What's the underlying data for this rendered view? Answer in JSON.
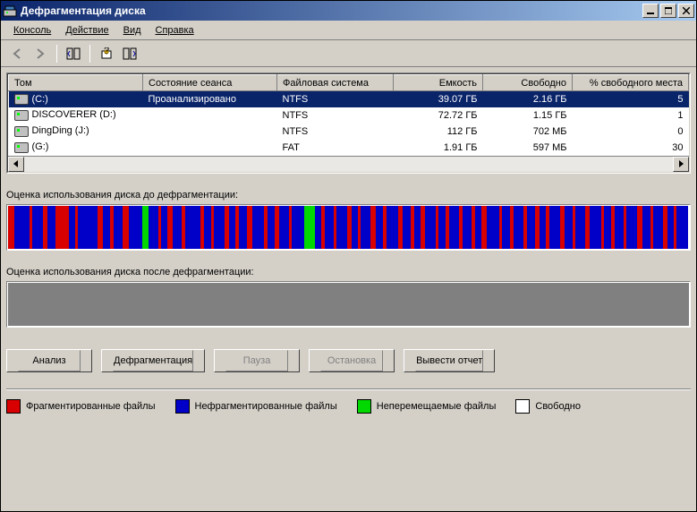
{
  "window": {
    "title": "Дефрагментация диска"
  },
  "menu": {
    "console": "Консоль",
    "action": "Действие",
    "view": "Вид",
    "help": "Справка"
  },
  "columns": {
    "volume": "Том",
    "session": "Состояние сеанса",
    "fs": "Файловая система",
    "capacity": "Емкость",
    "free": "Свободно",
    "pctfree": "% свободного места"
  },
  "rows": [
    {
      "volume": "(C:)",
      "session": "Проанализировано",
      "fs": "NTFS",
      "capacity": "39.07 ГБ",
      "free": "2.16 ГБ",
      "pctfree": "5",
      "selected": true
    },
    {
      "volume": "DISCOVERER (D:)",
      "session": "",
      "fs": "NTFS",
      "capacity": "72.72 ГБ",
      "free": "1.15 ГБ",
      "pctfree": "1",
      "selected": false
    },
    {
      "volume": "DingDing (J:)",
      "session": "",
      "fs": "NTFS",
      "capacity": "112 ГБ",
      "free": "702 МБ",
      "pctfree": "0",
      "selected": false
    },
    {
      "volume": "(G:)",
      "session": "",
      "fs": "FAT",
      "capacity": "1.91 ГБ",
      "free": "597 МБ",
      "pctfree": "30",
      "selected": false
    }
  ],
  "labels": {
    "before": "Оценка использования диска до дефрагментации:",
    "after": "Оценка использования диска после дефрагментации:"
  },
  "buttons": {
    "analyze": "Анализ",
    "defrag": "Дефрагментация",
    "pause": "Пауза",
    "stop": "Остановка",
    "report": "Вывести отчет"
  },
  "legend": {
    "fragmented": {
      "label": "Фрагментированные файлы",
      "color": "#d80000"
    },
    "contiguous": {
      "label": "Нефрагментированные файлы",
      "color": "#0000c8"
    },
    "unmovable": {
      "label": "Неперемещаемые файлы",
      "color": "#00d800"
    },
    "free": {
      "label": "Свободно",
      "color": "#ffffff"
    }
  },
  "chart_data": {
    "type": "bar",
    "title": "Оценка использования диска до дефрагментации",
    "categories_note": "Disk map stripes, color-coded by file state; widths are relative proportions of disk span.",
    "color_legend": {
      "red": "fragmented",
      "blue": "contiguous",
      "green": "unmovable",
      "white": "free"
    },
    "stripes": [
      {
        "c": "red",
        "w": 6
      },
      {
        "c": "blue",
        "w": 14
      },
      {
        "c": "red",
        "w": 3
      },
      {
        "c": "blue",
        "w": 10
      },
      {
        "c": "red",
        "w": 4
      },
      {
        "c": "blue",
        "w": 8
      },
      {
        "c": "red",
        "w": 12
      },
      {
        "c": "blue",
        "w": 6
      },
      {
        "c": "red",
        "w": 3
      },
      {
        "c": "blue",
        "w": 18
      },
      {
        "c": "red",
        "w": 5
      },
      {
        "c": "blue",
        "w": 7
      },
      {
        "c": "red",
        "w": 3
      },
      {
        "c": "blue",
        "w": 9
      },
      {
        "c": "red",
        "w": 6
      },
      {
        "c": "blue",
        "w": 12
      },
      {
        "c": "green",
        "w": 6
      },
      {
        "c": "blue",
        "w": 9
      },
      {
        "c": "red",
        "w": 3
      },
      {
        "c": "blue",
        "w": 6
      },
      {
        "c": "red",
        "w": 5
      },
      {
        "c": "blue",
        "w": 8
      },
      {
        "c": "red",
        "w": 4
      },
      {
        "c": "blue",
        "w": 14
      },
      {
        "c": "red",
        "w": 3
      },
      {
        "c": "blue",
        "w": 7
      },
      {
        "c": "red",
        "w": 3
      },
      {
        "c": "blue",
        "w": 10
      },
      {
        "c": "red",
        "w": 4
      },
      {
        "c": "blue",
        "w": 6
      },
      {
        "c": "red",
        "w": 3
      },
      {
        "c": "blue",
        "w": 8
      },
      {
        "c": "red",
        "w": 5
      },
      {
        "c": "blue",
        "w": 11
      },
      {
        "c": "red",
        "w": 3
      },
      {
        "c": "blue",
        "w": 7
      },
      {
        "c": "red",
        "w": 4
      },
      {
        "c": "blue",
        "w": 9
      },
      {
        "c": "red",
        "w": 3
      },
      {
        "c": "blue",
        "w": 12
      },
      {
        "c": "green",
        "w": 10
      },
      {
        "c": "blue",
        "w": 6
      },
      {
        "c": "red",
        "w": 3
      },
      {
        "c": "blue",
        "w": 8
      },
      {
        "c": "red",
        "w": 3
      },
      {
        "c": "blue",
        "w": 10
      },
      {
        "c": "red",
        "w": 4
      },
      {
        "c": "blue",
        "w": 6
      },
      {
        "c": "red",
        "w": 3
      },
      {
        "c": "blue",
        "w": 9
      },
      {
        "c": "red",
        "w": 5
      },
      {
        "c": "blue",
        "w": 7
      },
      {
        "c": "red",
        "w": 3
      },
      {
        "c": "blue",
        "w": 11
      },
      {
        "c": "red",
        "w": 4
      },
      {
        "c": "blue",
        "w": 8
      },
      {
        "c": "red",
        "w": 3
      },
      {
        "c": "blue",
        "w": 6
      },
      {
        "c": "red",
        "w": 4
      },
      {
        "c": "blue",
        "w": 10
      },
      {
        "c": "red",
        "w": 3
      },
      {
        "c": "blue",
        "w": 7
      },
      {
        "c": "red",
        "w": 3
      },
      {
        "c": "blue",
        "w": 9
      },
      {
        "c": "red",
        "w": 4
      },
      {
        "c": "blue",
        "w": 8
      },
      {
        "c": "red",
        "w": 3
      },
      {
        "c": "blue",
        "w": 6
      },
      {
        "c": "red",
        "w": 5
      },
      {
        "c": "blue",
        "w": 12
      },
      {
        "c": "red",
        "w": 3
      },
      {
        "c": "blue",
        "w": 7
      },
      {
        "c": "red",
        "w": 4
      },
      {
        "c": "blue",
        "w": 9
      },
      {
        "c": "red",
        "w": 3
      },
      {
        "c": "blue",
        "w": 8
      },
      {
        "c": "red",
        "w": 4
      },
      {
        "c": "blue",
        "w": 6
      },
      {
        "c": "red",
        "w": 3
      },
      {
        "c": "blue",
        "w": 10
      },
      {
        "c": "red",
        "w": 5
      },
      {
        "c": "blue",
        "w": 7
      },
      {
        "c": "red",
        "w": 3
      },
      {
        "c": "blue",
        "w": 9
      },
      {
        "c": "red",
        "w": 4
      },
      {
        "c": "blue",
        "w": 11
      },
      {
        "c": "red",
        "w": 3
      },
      {
        "c": "blue",
        "w": 6
      },
      {
        "c": "red",
        "w": 4
      },
      {
        "c": "blue",
        "w": 8
      },
      {
        "c": "red",
        "w": 3
      },
      {
        "c": "blue",
        "w": 10
      },
      {
        "c": "red",
        "w": 5
      },
      {
        "c": "blue",
        "w": 7
      },
      {
        "c": "red",
        "w": 3
      },
      {
        "c": "blue",
        "w": 9
      },
      {
        "c": "red",
        "w": 4
      },
      {
        "c": "blue",
        "w": 6
      },
      {
        "c": "red",
        "w": 3
      },
      {
        "c": "blue",
        "w": 11
      }
    ]
  }
}
